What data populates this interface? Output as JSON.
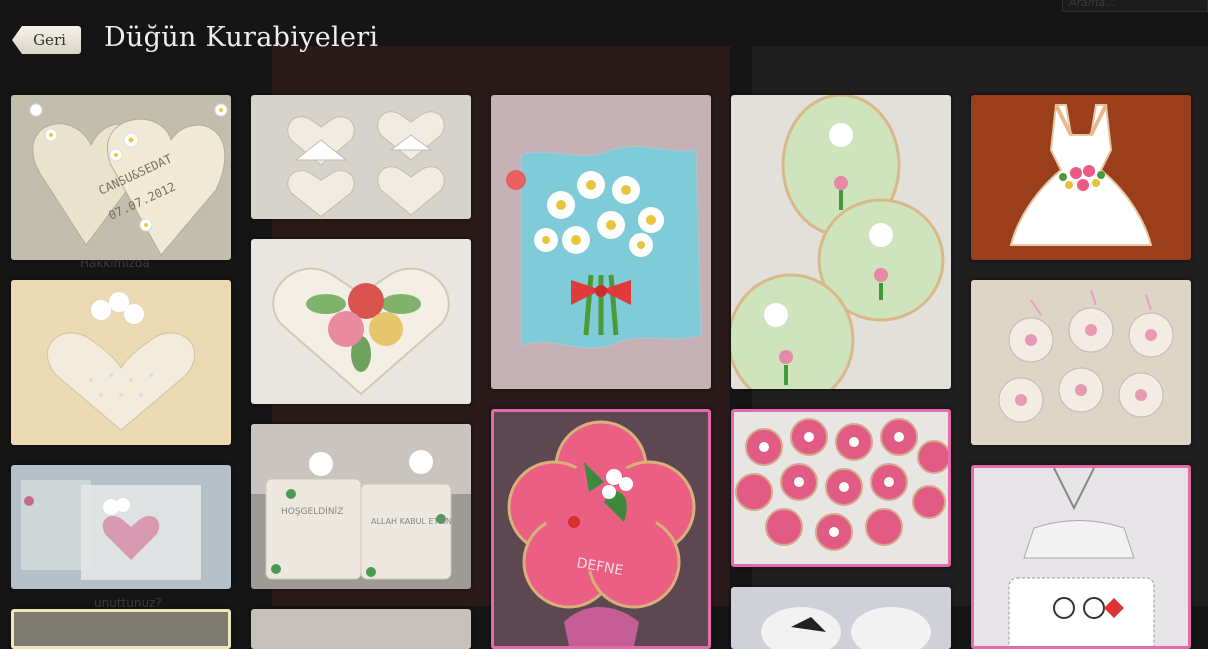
{
  "header": {
    "back_label": "Geri",
    "title": "Düğün Kurabiyeleri"
  },
  "background": {
    "search_placeholder": "Arama...",
    "faded_1": "Hakkımızda",
    "faded_2": "unuttunuz?"
  },
  "gallery": {
    "photos": [
      {
        "subject": "daisy heart cookies with names and date",
        "text1": "CANSU&SEDAT",
        "text2": "07.07.2012"
      },
      {
        "subject": "bride and groom heart cookies"
      },
      {
        "subject": "blue daisy bouquet cookie"
      },
      {
        "subject": "bouquet oval cookies"
      },
      {
        "subject": "wedding dress cookie"
      },
      {
        "subject": "cream lace heart cookie"
      },
      {
        "subject": "rose heart cookie"
      },
      {
        "subject": "pink flower cookie on stick",
        "text1": "DEFNE"
      },
      {
        "subject": "packed flower cookies in bags"
      },
      {
        "subject": "packed heart cookie"
      },
      {
        "subject": "square welcome cookies",
        "text1": "HOŞGELDİNİZ",
        "text2": "ALLAH KABUL ETSİN"
      },
      {
        "subject": "pink flower cookie pops"
      },
      {
        "subject": "bride and groom drawing cookie in bag"
      },
      {
        "subject": "partial photo"
      },
      {
        "subject": "partial photo"
      },
      {
        "subject": "partial photo"
      }
    ]
  },
  "colors": {
    "overlay": "#151515",
    "title": "#eeeeee",
    "selected_border": "#e56aa8",
    "cream_border": "#ece6b8"
  }
}
